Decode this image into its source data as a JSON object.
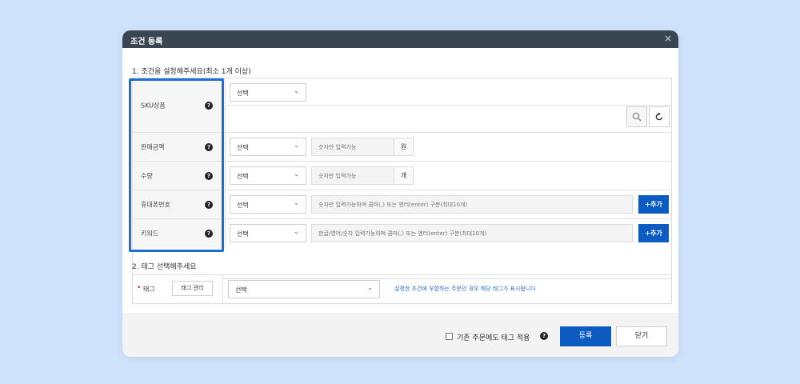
{
  "modal": {
    "title": "조건 등록",
    "close_label": "×"
  },
  "section1": {
    "title": "1. 조건을 설정해주세요(최소 1개 이상)"
  },
  "conditions": {
    "sku": {
      "label": "SKU상품",
      "select": "선택"
    },
    "amount": {
      "label": "판매금액",
      "select": "선택",
      "placeholder": "숫자만 입력가능",
      "unit": "원"
    },
    "quantity": {
      "label": "수량",
      "select": "선택",
      "placeholder": "숫자만 입력가능",
      "unit": "개"
    },
    "phone": {
      "label": "휴대폰번호",
      "select": "선택",
      "placeholder": "숫자만 입력가능하며 콤마(,) 또는 엔터(enter) 구분(최대10개)",
      "add_label": "+추가"
    },
    "keyword": {
      "label": "키워드",
      "select": "선택",
      "placeholder": "한글/영어/숫자 입력가능하며 콤마(,) 또는 엔터(enter) 구분(최대10개)",
      "add_label": "+추가"
    }
  },
  "help_glyph": "?",
  "chevron_glyph": "⌄",
  "section2": {
    "title": "2. 태그 선택해주세요"
  },
  "tag": {
    "required_mark": "•",
    "label": "태그",
    "manage_label": "태그 관리",
    "select": "선택",
    "hint": "설정한 조건에 부합하는 주문인 경우 해당 태그가 표시됩니다"
  },
  "footer": {
    "apply_existing_label": "기존 주문에도 태그 적용",
    "register_label": "등록",
    "close_label": "닫기"
  },
  "colors": {
    "accent": "#0b5bc1",
    "titlebar": "#3a4552",
    "highlight": "#1b6fd9",
    "background": "#cfe2fb"
  }
}
